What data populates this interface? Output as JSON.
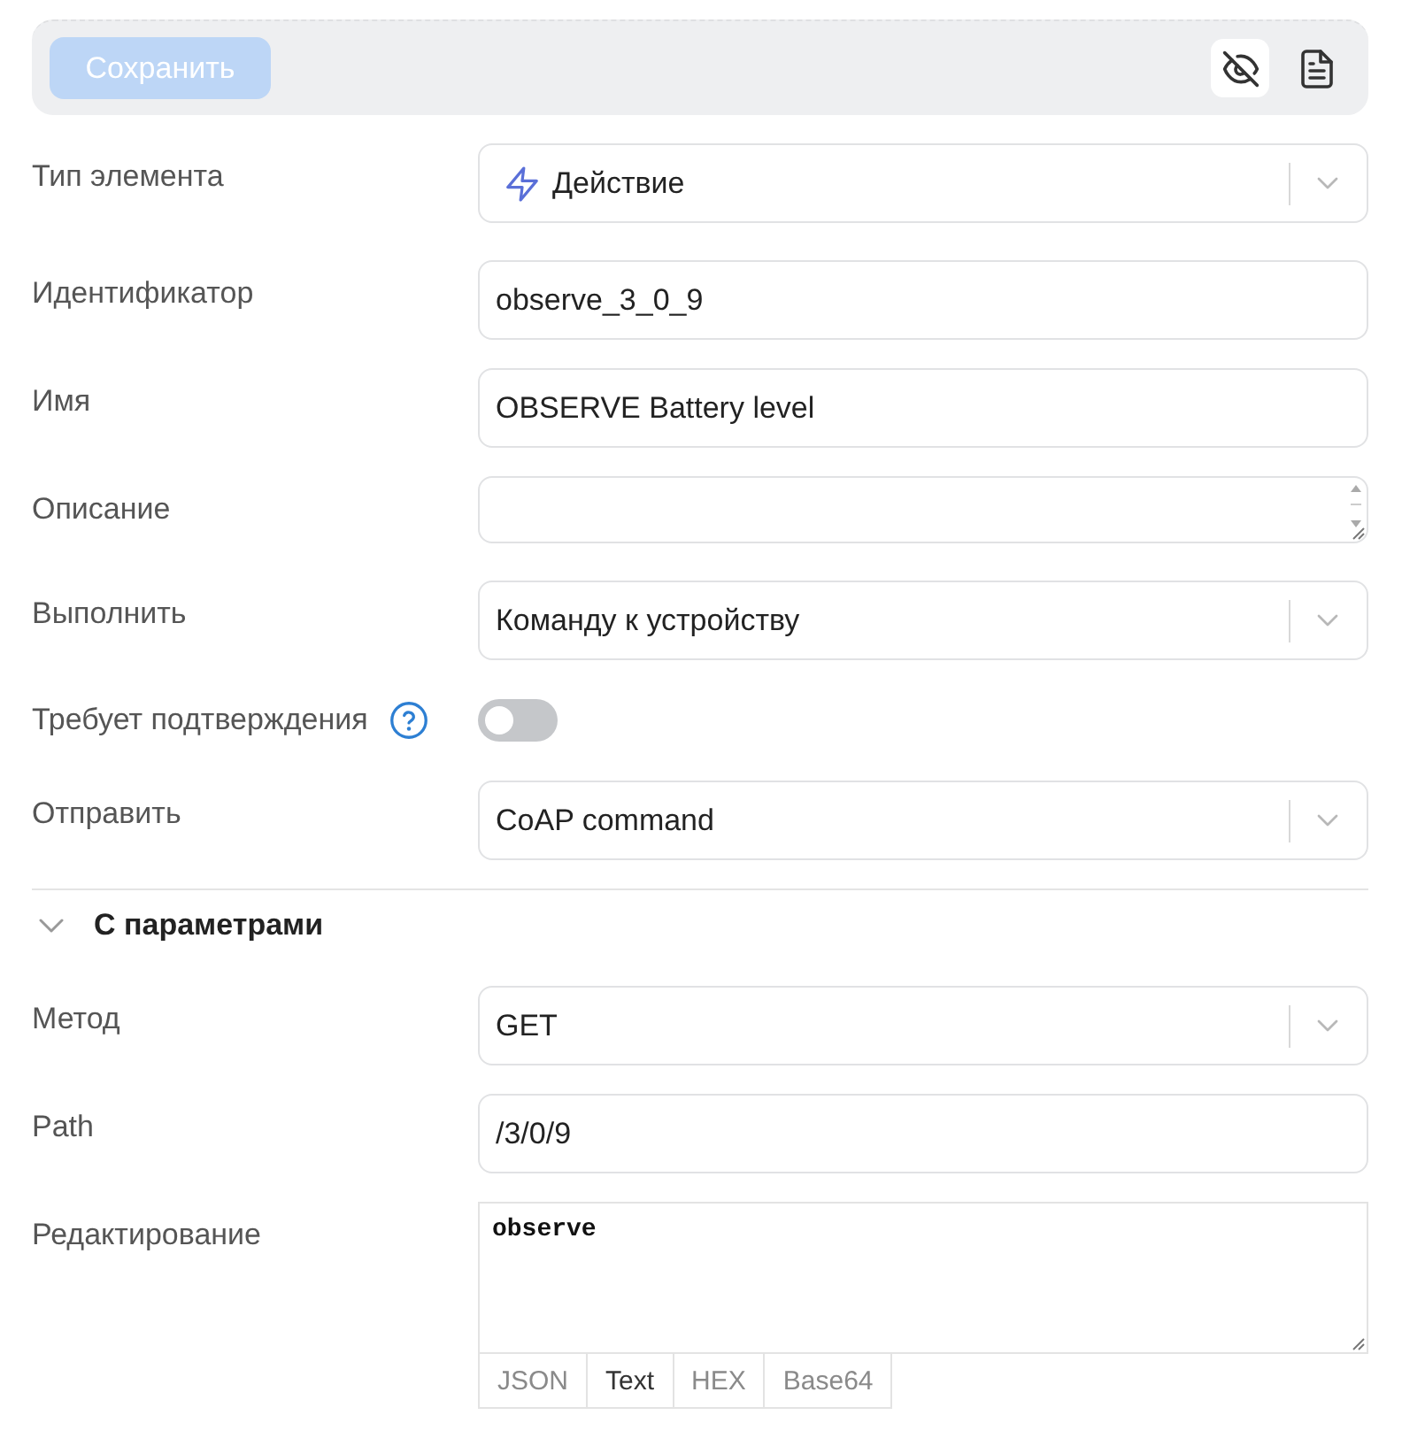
{
  "toolbar": {
    "save_button": {
      "label": "Сохранить",
      "disabled": true
    },
    "tools": [
      {
        "kind": "visibility",
        "selected": true
      },
      {
        "kind": "document",
        "selected": false
      }
    ]
  },
  "element_type": {
    "label": "Тип элемента",
    "value": "Действие"
  },
  "fields": [
    {
      "kind": "input",
      "label": "Идентификатор",
      "value": "observe_3_0_9"
    },
    {
      "kind": "input",
      "label": "Имя",
      "value": "OBSERVE Battery level"
    },
    {
      "kind": "textarea",
      "label": "Описание"
    },
    {
      "kind": "select",
      "label": "Выполнить",
      "value": "Команду к устройству"
    },
    {
      "kind": "toggle",
      "label": "Требует подтверждения",
      "help": true,
      "on": false
    },
    {
      "kind": "select",
      "label": "Отправить",
      "value": "CoAP command"
    }
  ],
  "parameters": {
    "title": "С параметрами",
    "expanded": true,
    "fields": [
      {
        "kind": "select",
        "label": "Метод",
        "value": "GET"
      },
      {
        "kind": "input",
        "label": "Path",
        "value": "/3/0/9"
      },
      {
        "kind": "editor",
        "label": "Редактирование",
        "value": "observe",
        "formats": [
          {
            "label": "JSON",
            "selected": false
          },
          {
            "label": "Text",
            "selected": true
          },
          {
            "label": "HEX",
            "selected": false
          },
          {
            "label": "Base64",
            "selected": false
          }
        ]
      }
    ]
  }
}
